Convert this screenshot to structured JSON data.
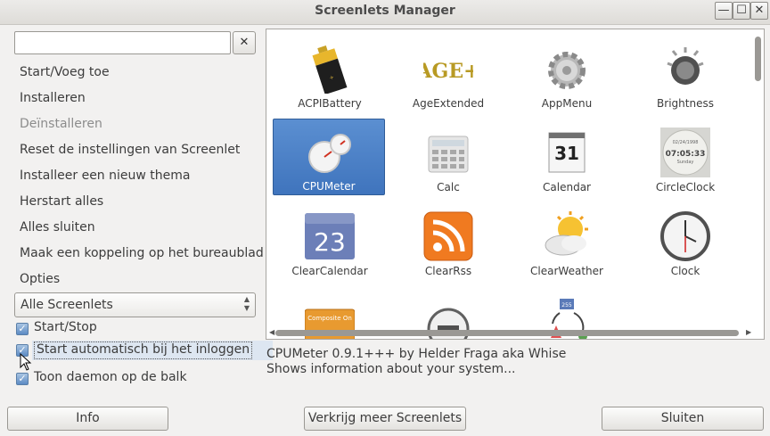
{
  "window": {
    "title": "Screenlets Manager",
    "minimize_glyph": "—",
    "maximize_glyph": "☐",
    "close_glyph": "✕"
  },
  "search": {
    "value": "",
    "clear_glyph": "✕"
  },
  "actions": [
    {
      "label": "Start/Voeg toe",
      "enabled": true
    },
    {
      "label": "Installeren",
      "enabled": true
    },
    {
      "label": "Deïnstalleren",
      "enabled": false
    },
    {
      "label": "Reset de instellingen van Screenlet",
      "enabled": true
    },
    {
      "label": "Installeer een nieuw thema",
      "enabled": true
    },
    {
      "label": "Herstart alles",
      "enabled": true
    },
    {
      "label": "Alles sluiten",
      "enabled": true
    },
    {
      "label": "Maak een koppeling op het bureaublad",
      "enabled": true
    },
    {
      "label": "Opties",
      "enabled": true
    }
  ],
  "filter": {
    "selected": "Alle Screenlets"
  },
  "checkboxes": [
    {
      "label": "Start/Stop",
      "checked": true
    },
    {
      "label": "Start automatisch bij het inloggen",
      "checked": true,
      "focused": true
    },
    {
      "label": "Toon daemon op de balk",
      "checked": true
    }
  ],
  "screenlets": [
    {
      "name": "ACPIBattery",
      "icon": "battery-icon"
    },
    {
      "name": "AgeExtended",
      "icon": "age-extended-icon"
    },
    {
      "name": "AppMenu",
      "icon": "gear-icon"
    },
    {
      "name": "Brightness",
      "icon": "brightness-icon"
    },
    {
      "name": "CPUMeter",
      "icon": "gauge-icon",
      "selected": true
    },
    {
      "name": "Calc",
      "icon": "calculator-icon"
    },
    {
      "name": "Calendar",
      "icon": "calendar-icon",
      "day": "31"
    },
    {
      "name": "CircleClock",
      "icon": "circle-clock-icon",
      "date": "02/24/1998",
      "time": "07:05:33",
      "weekday": "Sunday"
    },
    {
      "name": "ClearCalendar",
      "icon": "clear-calendar-icon",
      "day": "23"
    },
    {
      "name": "ClearRss",
      "icon": "rss-icon"
    },
    {
      "name": "ClearWeather",
      "icon": "weather-icon"
    },
    {
      "name": "Clock",
      "icon": "clock-icon"
    },
    {
      "name": "",
      "icon": "composite-icon",
      "text": "Composite On"
    },
    {
      "name": "",
      "icon": "minus-circle-icon"
    },
    {
      "name": "",
      "icon": "cycle-diagram-icon",
      "number": "255"
    }
  ],
  "description": {
    "line1": "CPUMeter 0.9.1+++ by Helder Fraga aka Whise",
    "line2": "Shows information about your system..."
  },
  "buttons": {
    "info": "Info",
    "more": "Verkrijg meer Screenlets",
    "close": "Sluiten"
  },
  "colors": {
    "selection": "#4a80c8",
    "checkbox": "#5c8bc4",
    "background": "#f2f1f0"
  }
}
